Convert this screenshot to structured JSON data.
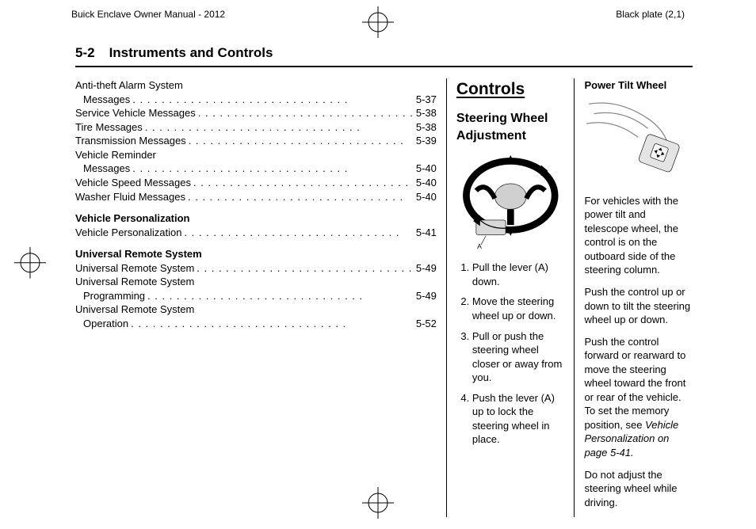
{
  "header": {
    "left": "Buick Enclave Owner Manual - 2012",
    "right": "Black plate (2,1)"
  },
  "page_number": "5-2",
  "chapter_title": "Instruments and Controls",
  "toc": {
    "loose_items": [
      {
        "text": "Anti-theft Alarm System",
        "cont": true
      },
      {
        "text": "Messages",
        "page": "5-37",
        "indent": true
      },
      {
        "text": "Service Vehicle Messages",
        "page": "5-38"
      },
      {
        "text": "Tire Messages",
        "page": "5-38"
      },
      {
        "text": "Transmission Messages",
        "page": "5-39"
      },
      {
        "text": "Vehicle Reminder",
        "cont": true
      },
      {
        "text": "Messages",
        "page": "5-40",
        "indent": true
      },
      {
        "text": "Vehicle Speed Messages",
        "page": "5-40"
      },
      {
        "text": "Washer Fluid Messages",
        "page": "5-40"
      }
    ],
    "groups": [
      {
        "head": "Vehicle Personalization",
        "items": [
          {
            "text": "Vehicle Personalization",
            "page": "5-41"
          }
        ]
      },
      {
        "head": "Universal Remote System",
        "items": [
          {
            "text": "Universal Remote System",
            "page": "5-49"
          },
          {
            "text": "Universal Remote System",
            "cont": true
          },
          {
            "text": "Programming",
            "page": "5-49",
            "indent": true
          },
          {
            "text": "Universal Remote System",
            "cont": true
          },
          {
            "text": "Operation",
            "page": "5-52",
            "indent": true
          }
        ]
      }
    ]
  },
  "col2": {
    "section": "Controls",
    "subsection": "Steering Wheel Adjustment",
    "figure_label": "A",
    "steps": [
      "Pull the lever (A) down.",
      "Move the steering wheel up or down.",
      "Pull or push the steering wheel closer or away from you.",
      "Push the lever (A) up to lock the steering wheel in place."
    ]
  },
  "col3": {
    "head": "Power Tilt Wheel",
    "paras": [
      "For vehicles with the power tilt and telescope wheel, the control is on the outboard side of the steering column.",
      "Push the control up or down to tilt the steering wheel up or down.",
      "Push the control forward or rearward to move the steering wheel toward the front or rear of the vehicle. To set the memory position, see ",
      "Do not adjust the steering wheel while driving."
    ],
    "see_ref": "Vehicle Personalization on page 5‑41."
  }
}
